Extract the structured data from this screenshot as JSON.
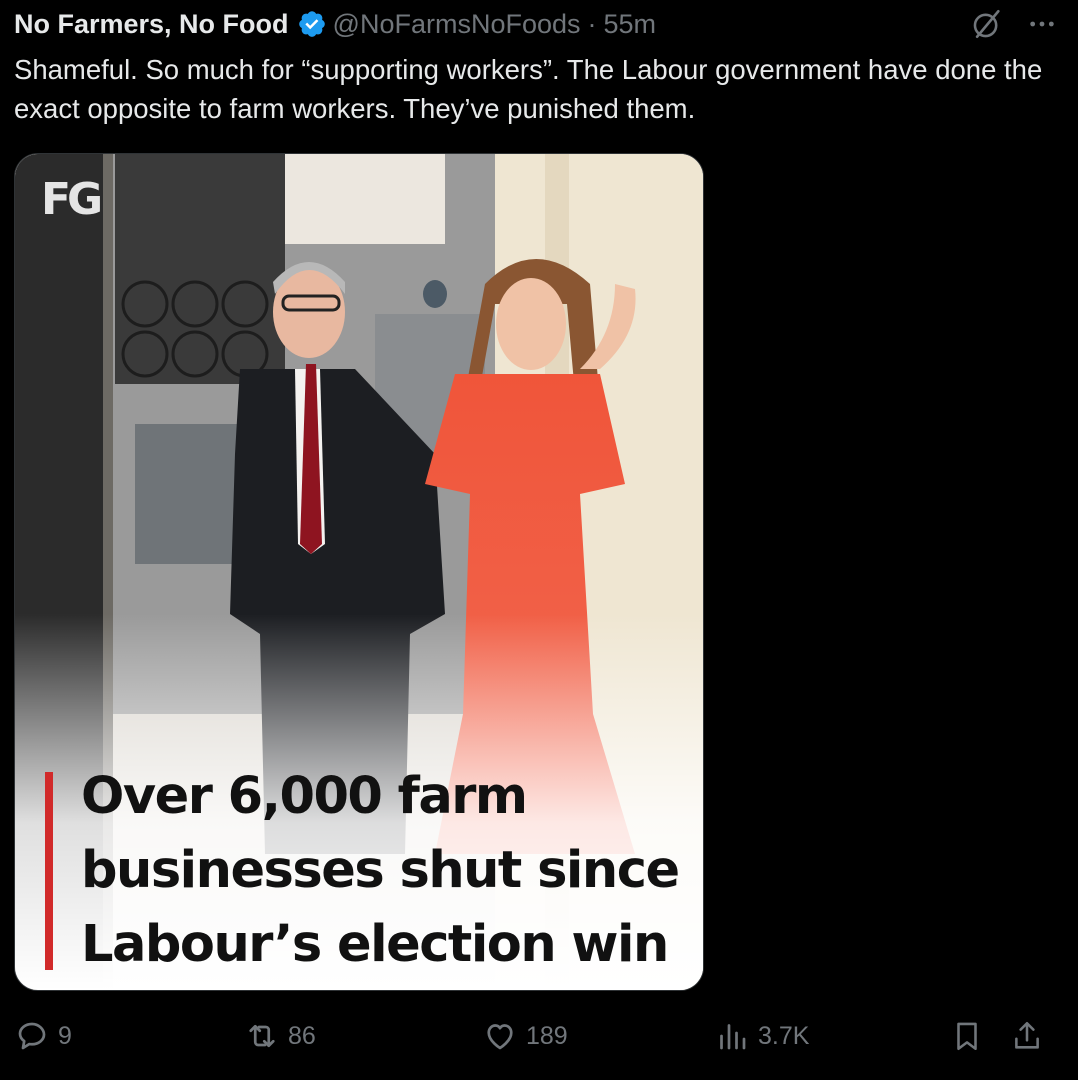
{
  "post": {
    "author_name": "No Farmers, No Food",
    "handle": "@NoFarmsNoFoods",
    "separator": "·",
    "time": "55m",
    "text": "Shameful. So much for “supporting workers”. The Labour government have done the exact opposite to farm workers. They’ve punished them."
  },
  "media": {
    "logo": "FG",
    "headline": "Over 6,000 farm businesses shut since Labour’s election win",
    "accent_color": "#d12a2a"
  },
  "actions": {
    "replies": "9",
    "reposts": "86",
    "likes": "189",
    "views": "3.7K"
  },
  "icons": [
    "verified-badge-icon",
    "grok-icon",
    "more-icon",
    "reply-icon",
    "repost-icon",
    "like-icon",
    "views-icon",
    "bookmark-icon",
    "share-icon"
  ],
  "colors": {
    "background": "#000000",
    "text": "#e7e9ea",
    "muted": "#71767b",
    "verified": "#1d9bf0"
  }
}
